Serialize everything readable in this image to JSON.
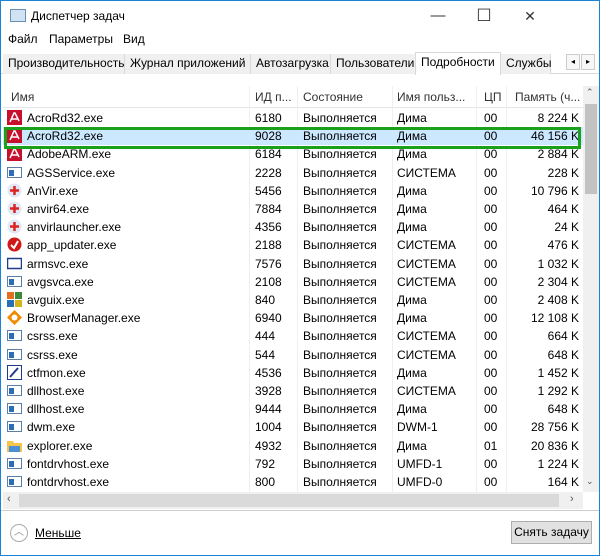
{
  "window": {
    "title": "Диспетчер задач",
    "minimize": "—",
    "maximize": "☐",
    "close": "✕"
  },
  "menu": [
    "Файл",
    "Параметры",
    "Вид"
  ],
  "tabs": [
    "Производительность",
    "Журнал приложений",
    "Автозагрузка",
    "Пользователи",
    "Подробности",
    "Службы"
  ],
  "tab_nav": {
    "left": "◂",
    "right": "▸"
  },
  "columns": [
    "Имя",
    "ИД п...",
    "Состояние",
    "Имя польз...",
    "ЦП",
    "Память (ч..."
  ],
  "rows": [
    {
      "name": "AcroRd32.exe",
      "pid": "6180",
      "state": "Выполняется",
      "user": "Дима",
      "cpu": "00",
      "mem": "8 224 K",
      "icon": "pdf"
    },
    {
      "name": "AcroRd32.exe",
      "pid": "9028",
      "state": "Выполняется",
      "user": "Дима",
      "cpu": "00",
      "mem": "46 156 K",
      "icon": "pdf"
    },
    {
      "name": "AdobeARM.exe",
      "pid": "6184",
      "state": "Выполняется",
      "user": "Дима",
      "cpu": "00",
      "mem": "2 884 K",
      "icon": "pdf"
    },
    {
      "name": "AGSService.exe",
      "pid": "2228",
      "state": "Выполняется",
      "user": "СИСТЕМА",
      "cpu": "00",
      "mem": "228 K",
      "icon": "app"
    },
    {
      "name": "AnVir.exe",
      "pid": "5456",
      "state": "Выполняется",
      "user": "Дима",
      "cpu": "00",
      "mem": "10 796 K",
      "icon": "cross"
    },
    {
      "name": "anvir64.exe",
      "pid": "7884",
      "state": "Выполняется",
      "user": "Дима",
      "cpu": "00",
      "mem": "464 K",
      "icon": "cross"
    },
    {
      "name": "anvirlauncher.exe",
      "pid": "4356",
      "state": "Выполняется",
      "user": "Дима",
      "cpu": "00",
      "mem": "24 K",
      "icon": "cross"
    },
    {
      "name": "app_updater.exe",
      "pid": "2188",
      "state": "Выполняется",
      "user": "СИСТЕМА",
      "cpu": "00",
      "mem": "476 K",
      "icon": "updater"
    },
    {
      "name": "armsvc.exe",
      "pid": "7576",
      "state": "Выполняется",
      "user": "СИСТЕМА",
      "cpu": "00",
      "mem": "1 032 K",
      "icon": "frame"
    },
    {
      "name": "avgsvca.exe",
      "pid": "2108",
      "state": "Выполняется",
      "user": "СИСТЕМА",
      "cpu": "00",
      "mem": "2 304 K",
      "icon": "app"
    },
    {
      "name": "avguix.exe",
      "pid": "840",
      "state": "Выполняется",
      "user": "Дима",
      "cpu": "00",
      "mem": "2 408 K",
      "icon": "avg"
    },
    {
      "name": "BrowserManager.exe",
      "pid": "6940",
      "state": "Выполняется",
      "user": "Дима",
      "cpu": "00",
      "mem": "12 108 K",
      "icon": "browser"
    },
    {
      "name": "csrss.exe",
      "pid": "444",
      "state": "Выполняется",
      "user": "СИСТЕМА",
      "cpu": "00",
      "mem": "664 K",
      "icon": "app"
    },
    {
      "name": "csrss.exe",
      "pid": "544",
      "state": "Выполняется",
      "user": "СИСТЕМА",
      "cpu": "00",
      "mem": "648 K",
      "icon": "app"
    },
    {
      "name": "ctfmon.exe",
      "pid": "4536",
      "state": "Выполняется",
      "user": "Дима",
      "cpu": "00",
      "mem": "1 452 K",
      "icon": "pen"
    },
    {
      "name": "dllhost.exe",
      "pid": "3928",
      "state": "Выполняется",
      "user": "СИСТЕМА",
      "cpu": "00",
      "mem": "1 292 K",
      "icon": "app"
    },
    {
      "name": "dllhost.exe",
      "pid": "9444",
      "state": "Выполняется",
      "user": "Дима",
      "cpu": "00",
      "mem": "648 K",
      "icon": "app"
    },
    {
      "name": "dwm.exe",
      "pid": "1004",
      "state": "Выполняется",
      "user": "DWM-1",
      "cpu": "00",
      "mem": "28 756 K",
      "icon": "app"
    },
    {
      "name": "explorer.exe",
      "pid": "4932",
      "state": "Выполняется",
      "user": "Дима",
      "cpu": "01",
      "mem": "20 836 K",
      "icon": "folder"
    },
    {
      "name": "fontdrvhost.exe",
      "pid": "792",
      "state": "Выполняется",
      "user": "UMFD-1",
      "cpu": "00",
      "mem": "1 224 K",
      "icon": "app"
    },
    {
      "name": "fontdrvhost.exe",
      "pid": "800",
      "state": "Выполняется",
      "user": "UMFD-0",
      "cpu": "00",
      "mem": "164 K",
      "icon": "app"
    }
  ],
  "selected_index": 1,
  "footer": {
    "less": "Меньше",
    "end_task": "Снять задачу"
  },
  "colors": {
    "selection": "#cce8ff",
    "highlight": "#1aa01a",
    "accent": "#1883d7"
  }
}
